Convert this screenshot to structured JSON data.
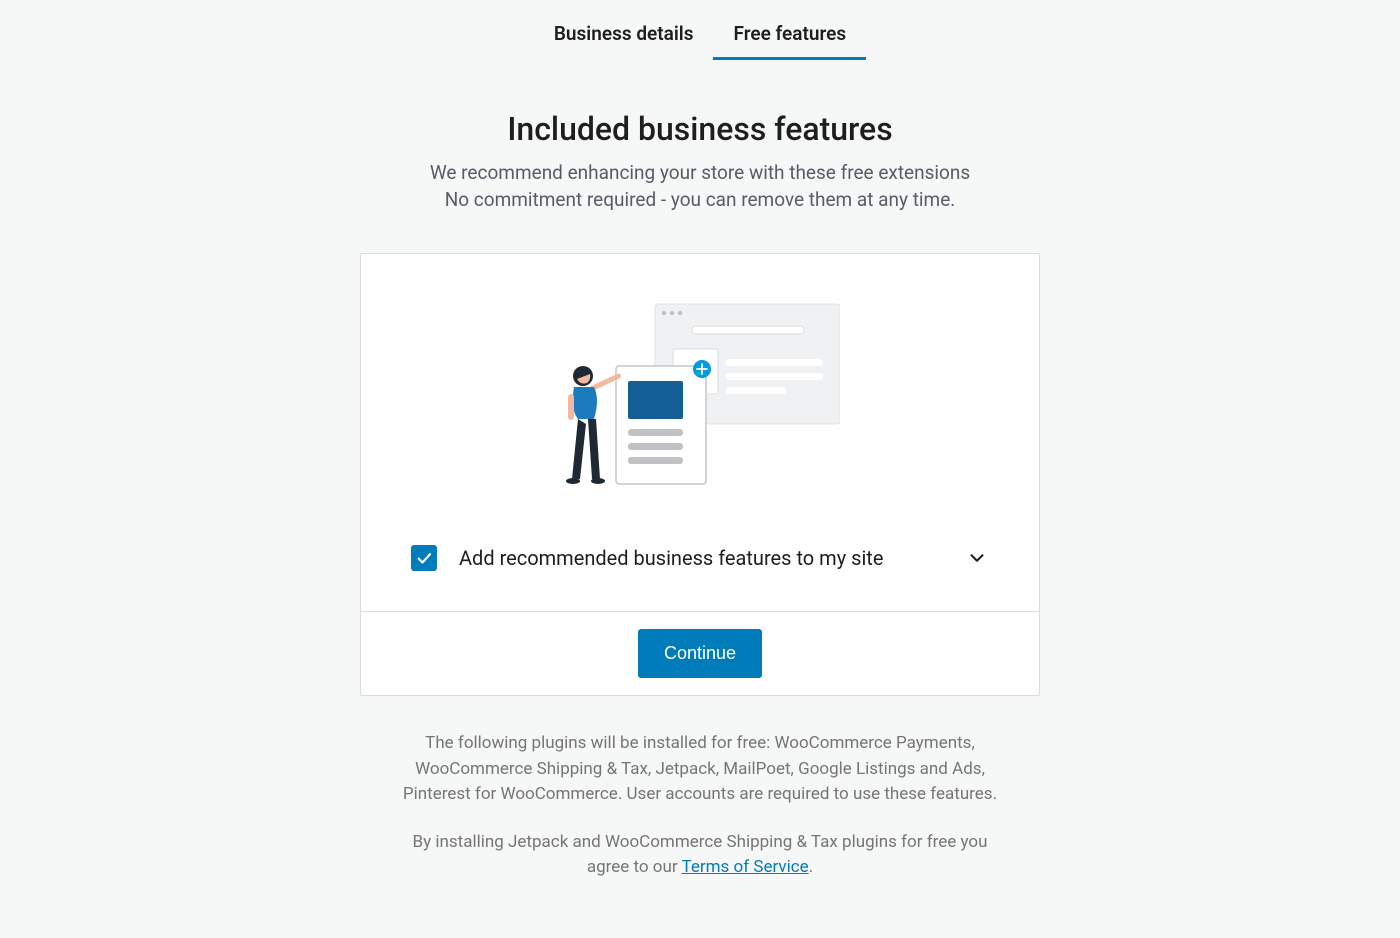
{
  "tabs": {
    "business_details": "Business details",
    "free_features": "Free features"
  },
  "header": {
    "title": "Included business features",
    "line1": "We recommend enhancing your store with these free extensions",
    "line2": "No commitment required - you can remove them at any time."
  },
  "option": {
    "label": "Add recommended business features to my site",
    "checked": true
  },
  "continue_button": "Continue",
  "footer": {
    "plugins_text": "The following plugins will be installed for free: WooCommerce Payments, WooCommerce Shipping & Tax, Jetpack, MailPoet, Google Listings and Ads, Pinterest for WooCommerce. User accounts are required to use these features.",
    "terms_prefix": "By installing Jetpack and WooCommerce Shipping & Tax plugins for free you agree to our ",
    "terms_link": "Terms of Service",
    "terms_suffix": "."
  },
  "colors": {
    "primary": "#007cba",
    "bg": "#f6f7f7",
    "border": "#dcdcde"
  }
}
